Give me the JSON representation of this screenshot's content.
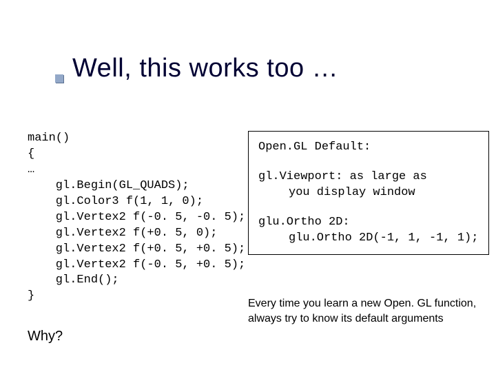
{
  "title": "Well, this works too …",
  "code": {
    "l0": "main()",
    "l1": "{",
    "l2": "…",
    "l3": "    gl.Begin(GL_QUADS);",
    "l4": "    gl.Color3 f(1, 1, 0);",
    "l5": "    gl.Vertex2 f(-0. 5, -0. 5);",
    "l6": "    gl.Vertex2 f(+0. 5, 0);",
    "l7": "    gl.Vertex2 f(+0. 5, +0. 5);",
    "l8": "    gl.Vertex2 f(-0. 5, +0. 5);",
    "l9": "    gl.End();",
    "l10": "}"
  },
  "why": "Why?",
  "box": {
    "header": "Open.GL Default:",
    "viewport_a": "gl.Viewport: as large as",
    "viewport_b": "you display window",
    "ortho_a": "glu.Ortho 2D:",
    "ortho_b": "glu.Ortho 2D(-1, 1, -1, 1);"
  },
  "footnote": "Every time you learn a new Open. GL function, always try to know its default arguments"
}
